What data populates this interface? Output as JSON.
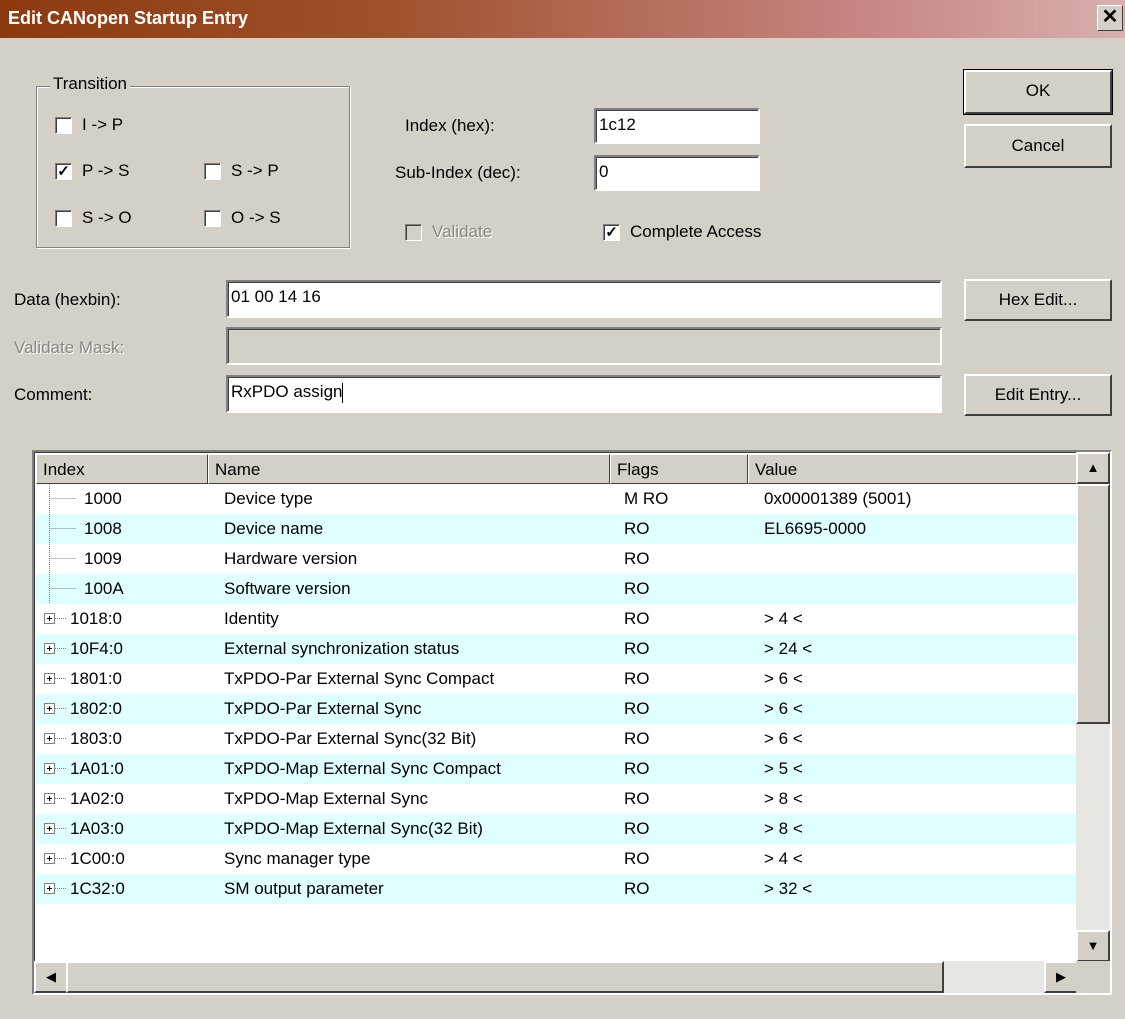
{
  "window": {
    "title": "Edit CANopen Startup Entry",
    "close_glyph": "✕"
  },
  "transition": {
    "label": "Transition",
    "items": [
      {
        "label": "I -> P",
        "checked": false
      },
      {
        "label": "P -> S",
        "checked": true
      },
      {
        "label": "S -> P",
        "checked": false
      },
      {
        "label": "S -> O",
        "checked": false
      },
      {
        "label": "O -> S",
        "checked": false
      }
    ]
  },
  "fields": {
    "index_label": "Index (hex):",
    "index_value": "1c12",
    "subindex_label": "Sub-Index (dec):",
    "subindex_value": "0",
    "validate_label": "Validate",
    "complete_access_label": "Complete Access",
    "data_label": "Data (hexbin):",
    "data_value": "01 00 14 16",
    "validate_mask_label": "Validate Mask:",
    "validate_mask_value": "",
    "comment_label": "Comment:",
    "comment_value": "RxPDO assign"
  },
  "buttons": {
    "ok": "OK",
    "cancel": "Cancel",
    "hex_edit": "Hex Edit...",
    "edit_entry": "Edit Entry..."
  },
  "table": {
    "columns": [
      "Index",
      "Name",
      "Flags",
      "Value"
    ],
    "rows": [
      {
        "index": "1000",
        "name": "Device type",
        "flags": "M RO",
        "value": "0x00001389 (5001)",
        "expandable": false
      },
      {
        "index": "1008",
        "name": "Device name",
        "flags": "RO",
        "value": "EL6695-0000",
        "expandable": false
      },
      {
        "index": "1009",
        "name": "Hardware version",
        "flags": "RO",
        "value": "",
        "expandable": false
      },
      {
        "index": "100A",
        "name": "Software version",
        "flags": "RO",
        "value": "",
        "expandable": false
      },
      {
        "index": "1018:0",
        "name": "Identity",
        "flags": "RO",
        "value": "> 4 <",
        "expandable": true
      },
      {
        "index": "10F4:0",
        "name": "External synchronization status",
        "flags": "RO",
        "value": "> 24 <",
        "expandable": true
      },
      {
        "index": "1801:0",
        "name": "TxPDO-Par External Sync Compact",
        "flags": "RO",
        "value": "> 6 <",
        "expandable": true
      },
      {
        "index": "1802:0",
        "name": "TxPDO-Par External Sync",
        "flags": "RO",
        "value": "> 6 <",
        "expandable": true
      },
      {
        "index": "1803:0",
        "name": "TxPDO-Par External Sync(32 Bit)",
        "flags": "RO",
        "value": "> 6 <",
        "expandable": true
      },
      {
        "index": "1A01:0",
        "name": "TxPDO-Map External Sync Compact",
        "flags": "RO",
        "value": "> 5 <",
        "expandable": true
      },
      {
        "index": "1A02:0",
        "name": "TxPDO-Map External Sync",
        "flags": "RO",
        "value": "> 8 <",
        "expandable": true
      },
      {
        "index": "1A03:0",
        "name": "TxPDO-Map External Sync(32 Bit)",
        "flags": "RO",
        "value": "> 8 <",
        "expandable": true
      },
      {
        "index": "1C00:0",
        "name": "Sync manager type",
        "flags": "RO",
        "value": "> 4 <",
        "expandable": true
      },
      {
        "index": "1C32:0",
        "name": "SM output parameter",
        "flags": "RO",
        "value": "> 32 <",
        "expandable": true
      }
    ]
  },
  "colors": {
    "title_start": "#8b3a10",
    "alt_row": "#e0ffff",
    "face": "#d4d0c8"
  }
}
